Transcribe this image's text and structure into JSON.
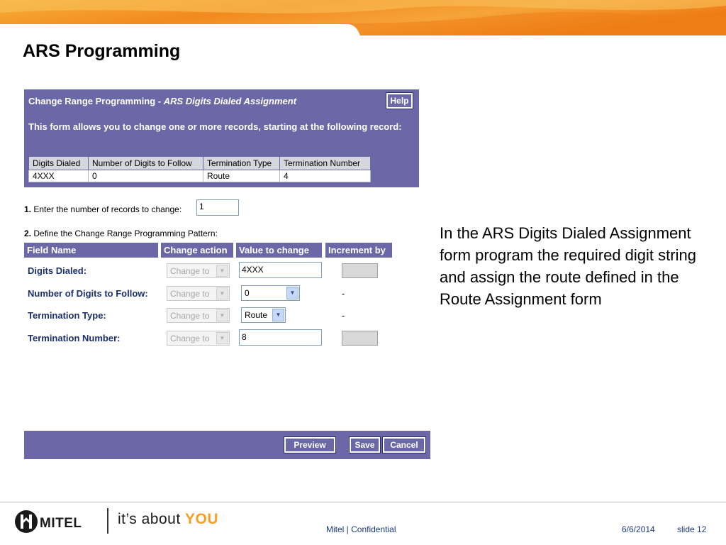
{
  "slide": {
    "title": "ARS Programming",
    "explanation": "In the ARS Digits Dialed Assignment form program the required digit string and assign the route defined in the Route Assignment form"
  },
  "form": {
    "title_prefix": "Change Range Programming - ",
    "title_italic": "ARS Digits Dialed Assignment",
    "help_label": "Help",
    "description": "This form allows you to change one or more records, starting at the following record:",
    "record_headers": [
      "Digits Dialed",
      "Number of Digits to Follow",
      "Termination Type",
      "Termination Number"
    ],
    "record_values": [
      "4XXX",
      "0",
      "Route",
      "4"
    ],
    "step1_num": "1.",
    "step1_text": "Enter the number of records to change:",
    "records_value": "1",
    "step2_num": "2.",
    "step2_text": "Define the Change Range Programming Pattern:",
    "pattern_headers": {
      "field_name": "Field Name",
      "change_action": "Change action",
      "value_to_change": "Value to change",
      "increment_by": "Increment by"
    },
    "rows": [
      {
        "label": "Digits Dialed:",
        "action": "Change to",
        "value": "4XXX",
        "increment": ""
      },
      {
        "label": "Number of Digits to Follow:",
        "action": "Change to",
        "value": "0",
        "increment": "-"
      },
      {
        "label": "Termination Type:",
        "action": "Change to",
        "value": "Route",
        "increment": "-"
      },
      {
        "label": "Termination Number:",
        "action": "Change to",
        "value": "8",
        "increment": ""
      }
    ],
    "buttons": {
      "preview": "Preview",
      "save": "Save",
      "cancel": "Cancel"
    }
  },
  "footer": {
    "brand": "MITEL",
    "tagline_prefix": "it’s about ",
    "tagline_highlight": "YOU",
    "confidential": "Mitel | Confidential",
    "date": "6/6/2014",
    "slide_label": "slide 12"
  },
  "colors": {
    "panel": "#6b68a8",
    "accent_orange": "#f5a020",
    "label_blue": "#1c2f6e"
  }
}
